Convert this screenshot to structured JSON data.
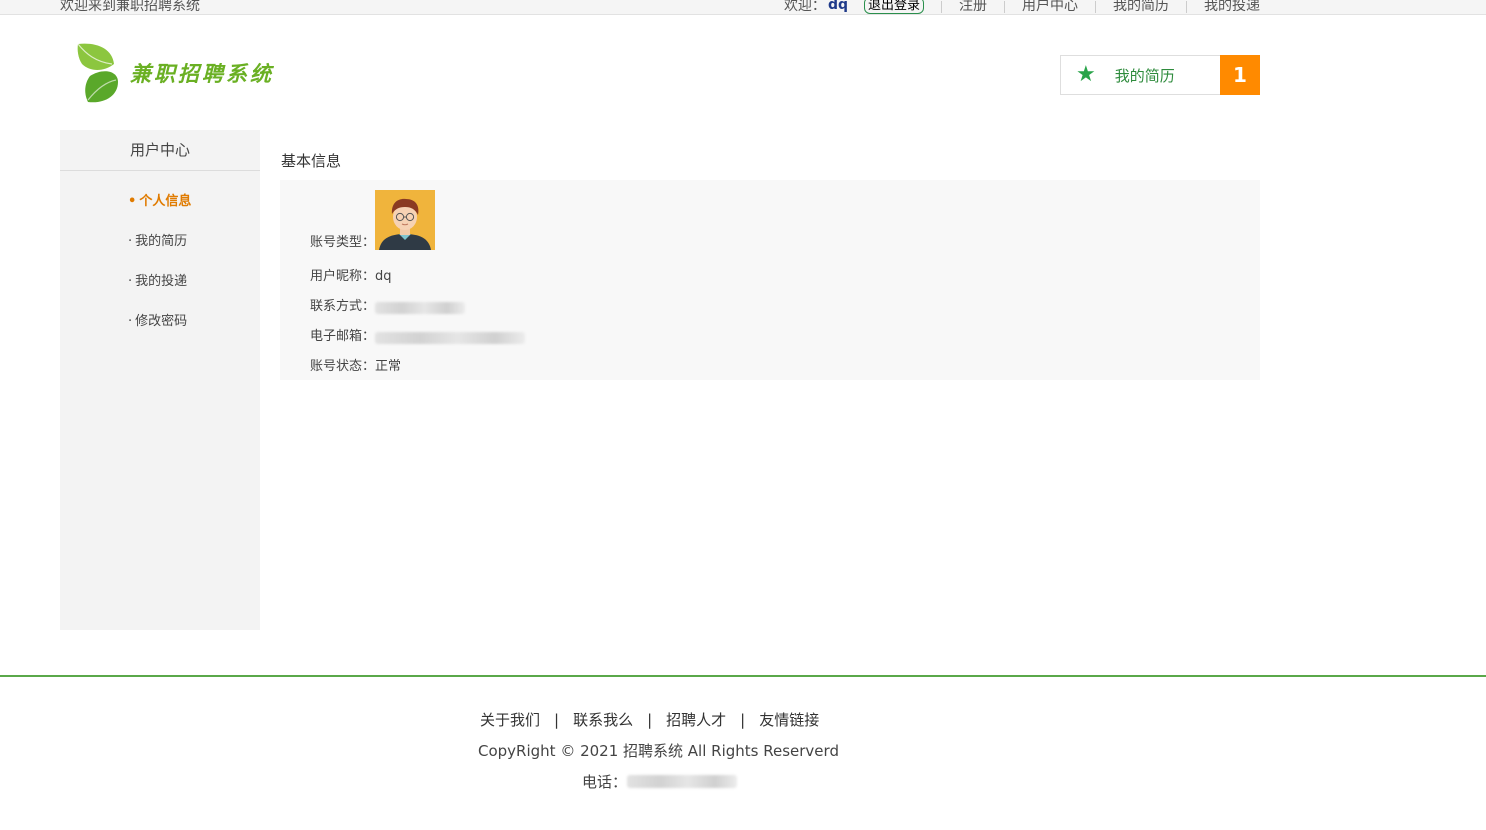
{
  "topbar": {
    "site_welcome": "欢迎来到兼职招聘系统",
    "welcome_prefix": "欢迎：",
    "user_name": "dq",
    "logout": "退出登录",
    "nav": [
      "注册",
      "用户中心",
      "我的简历",
      "我的投递"
    ]
  },
  "header": {
    "logo_text": "兼职招聘系统",
    "resume_label": "我的简历",
    "resume_count": "1",
    "icons": {
      "star": "star-icon",
      "logo": "leaf-logo-icon"
    },
    "colors": {
      "star": "#2aa44a",
      "count_bg": "#ff8a00",
      "logo": "#6ab023"
    }
  },
  "sidebar": {
    "title": "用户中心",
    "items": [
      {
        "label": "个人信息",
        "active": true
      },
      {
        "label": "我的简历",
        "active": false
      },
      {
        "label": "我的投递",
        "active": false
      },
      {
        "label": "修改密码",
        "active": false
      }
    ],
    "active_color": "#e07b00"
  },
  "main": {
    "section_title": "基本信息",
    "fields": {
      "account_type": {
        "label": "账号类型："
      },
      "nickname": {
        "label": "用户昵称：",
        "value": "dq"
      },
      "contact": {
        "label": "联系方式："
      },
      "email": {
        "label": "电子邮箱："
      },
      "status": {
        "label": "账号状态：",
        "value": "正常"
      }
    }
  },
  "footer": {
    "links": [
      "关于我们",
      "联系我么",
      "招聘人才",
      "友情链接"
    ],
    "separator": "|",
    "copyright": "CopyRight © 2021 招聘系统 All Rights Reserverd",
    "phone_label": "电话：",
    "line_color": "#5aa84a"
  }
}
